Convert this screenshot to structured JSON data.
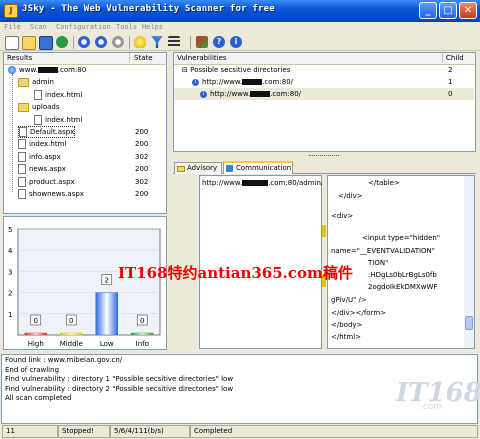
{
  "window": {
    "title": "JSky - The Web Vulnerability Scanner for free",
    "min": "_",
    "max": "□",
    "close": "✕"
  },
  "menu": [
    "File",
    "Scan",
    "Configuration",
    "Tools",
    "Helps"
  ],
  "toolbar": {
    "icons": [
      "new-icon",
      "open-icon",
      "save-icon",
      "refresh-icon",
      "start-scan-icon",
      "pause-icon",
      "stop-icon",
      "idea-icon",
      "filter-icon",
      "view-menu-icon",
      "target-icon",
      "help-icon",
      "about-icon"
    ]
  },
  "results": {
    "col_results": "Results",
    "col_state": "State",
    "tree": [
      {
        "label": "www.",
        "suffix": ".com:80",
        "state": ""
      },
      {
        "label": "admin",
        "state": ""
      },
      {
        "label": "index.html",
        "state": ""
      },
      {
        "label": "uploads",
        "state": ""
      },
      {
        "label": "index.html",
        "state": ""
      },
      {
        "label": "Default.aspx",
        "state": "200"
      },
      {
        "label": "index.html",
        "state": "200"
      },
      {
        "label": "info.aspx",
        "state": "302"
      },
      {
        "label": "news.aspx",
        "state": "200"
      },
      {
        "label": "product.aspx",
        "state": "302"
      },
      {
        "label": "shownews.aspx",
        "state": "200"
      }
    ]
  },
  "vulns": {
    "col_vuln": "Vulnerabilities",
    "col_child": "Child",
    "rows": [
      {
        "label": "Possible secsitive directories",
        "child": "2"
      },
      {
        "label": "http://www.",
        "suffix": ".com:80/",
        "child": "1"
      },
      {
        "label": "http://www.",
        "suffix": ".com:80/",
        "child": "0"
      }
    ]
  },
  "tabs": {
    "advisory": "Advisory",
    "communication": "Communication"
  },
  "comm": {
    "url_prefix": "http://www.",
    "url_suffix": ".com:80/admin/",
    "code_lines": [
      "</table>",
      "</div>",
      "<div>",
      "<input type=\"hidden\"",
      "name=\"__EVENTVALIDATION\"",
      "TION\"",
      ":HDgLs0bLrBgLs0fb",
      "2ogdoIkEkDMXwWF",
      "gPiv/U\" />",
      "</div></form>",
      "</body>",
      "</html>"
    ]
  },
  "chart_data": {
    "type": "bar",
    "categories": [
      "High",
      "Middle",
      "Low",
      "Info"
    ],
    "values": [
      0,
      0,
      2,
      0
    ],
    "value_labels": [
      "0",
      "0",
      "2",
      "0"
    ],
    "yticks": [
      "1",
      "2",
      "3",
      "4",
      "5"
    ],
    "ylim": [
      0,
      5
    ],
    "bar_colors": [
      "#d03a2a",
      "#e8c020",
      "#2f6ce0",
      "#3aa040"
    ]
  },
  "watermark": "IT168特约antian365.com稿件",
  "log": [
    "Found link : www.mibeian.gov.cn/",
    "End of crawling",
    "Find vulnerability : directory 1 \"Possible secsitive directories\" low",
    "Find vulnerability : directory 2 \"Possible secsitive directories\" low",
    "All scan completed"
  ],
  "status": {
    "c1": "11",
    "c2": "Stopped!",
    "c3": "5/6/4/111(b/s)",
    "c4": "Completed"
  },
  "brand": {
    "logo": "IT168",
    "sub": ".com"
  }
}
